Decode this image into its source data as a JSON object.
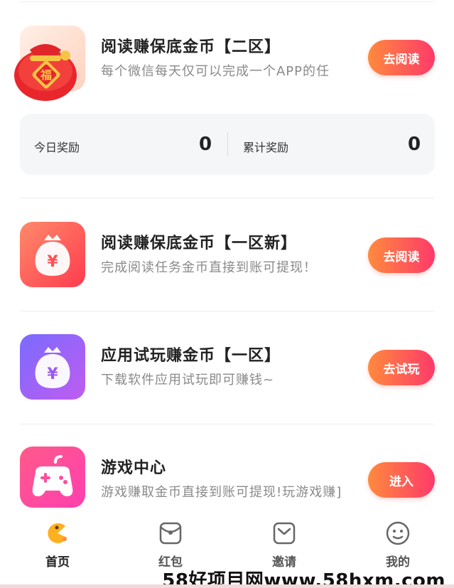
{
  "tasks": [
    {
      "title": "阅读赚保底金币【二区】",
      "subtitle": "每个微信每天仅可以完成一个APP的任",
      "button": "去阅读",
      "icon": "lucky-bag-icon"
    },
    {
      "title": "阅读赚保底金币【一区新】",
      "subtitle": "完成阅读任务金币直接到账可提现！",
      "button": "去阅读",
      "icon": "money-bag-icon"
    },
    {
      "title": "应用试玩赚金币【一区】",
      "subtitle": "下载软件应用试玩即可赚钱~",
      "button": "去试玩",
      "icon": "money-bag-icon"
    },
    {
      "title": "游戏中心",
      "subtitle": "游戏赚取金币直接到账可提现!玩游戏赚]",
      "button": "进入",
      "icon": "gamepad-icon"
    }
  ],
  "stats": {
    "today_label": "今日奖励",
    "today_value": "0",
    "total_label": "累计奖励",
    "total_value": "0"
  },
  "lucky_bag_char": "福",
  "yen_symbol": "¥",
  "tabbar": [
    {
      "label": "首页",
      "icon": "home-pacman-icon",
      "active": true
    },
    {
      "label": "红包",
      "icon": "red-envelope-icon",
      "active": false
    },
    {
      "label": "邀请",
      "icon": "invite-envelope-icon",
      "active": false
    },
    {
      "label": "我的",
      "icon": "profile-face-icon",
      "active": false
    }
  ],
  "watermark": "58好项目网www.58hxm.com",
  "colors": {
    "accent_start": "#ff8a3d",
    "accent_end": "#ff3a6a",
    "violet": "#8b5cf6",
    "pink": "#ff4f9a"
  }
}
